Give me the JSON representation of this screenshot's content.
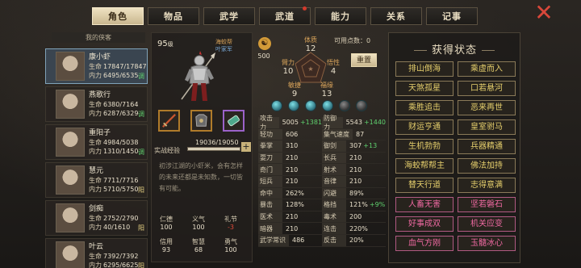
{
  "tabs": [
    {
      "label": "角色",
      "active": true
    },
    {
      "label": "物品"
    },
    {
      "label": "武学"
    },
    {
      "label": "武道",
      "badge": true
    },
    {
      "label": "能力"
    },
    {
      "label": "关系"
    },
    {
      "label": "记事"
    }
  ],
  "close_icon": "close-x-icon",
  "roster": {
    "title": "我的侠客",
    "members": [
      {
        "name": "康小虾",
        "hp": "17847/17847",
        "mp": "6495/6535",
        "tag": "调",
        "selected": true
      },
      {
        "name": "燕歌行",
        "hp": "6380/7164",
        "mp": "6287/6329",
        "tag": "调"
      },
      {
        "name": "重阳子",
        "hp": "4984/5038",
        "mp": "1310/1450",
        "tag": "调"
      },
      {
        "name": "慧元",
        "hp": "7711/7716",
        "mp": "5710/5750",
        "tag": "阳"
      },
      {
        "name": "剑痴",
        "hp": "2752/2790",
        "mp": "40/1610",
        "tag": "阳"
      },
      {
        "name": "叶云",
        "hp": "7392/7392",
        "mp": "6295/6625",
        "tag": "阳"
      }
    ],
    "hp_label": "生命",
    "mp_label": "内力"
  },
  "character": {
    "level": "95",
    "level_unit": "级",
    "sect": "海蛟帮",
    "sect_title": "叶家军",
    "exp_label": "实战经验",
    "exp_text": "19036/19050",
    "exp_fraction": 0.999,
    "description": "初涉江湖的小虾米，会有怎样的未来还都是未知数，一切皆有可能。",
    "virtues": [
      {
        "label": "仁德",
        "value": "100"
      },
      {
        "label": "义气",
        "value": "100"
      },
      {
        "label": "礼节",
        "value": "-3",
        "negative": true
      },
      {
        "label": "信用",
        "value": "93"
      },
      {
        "label": "智慧",
        "value": "68"
      },
      {
        "label": "勇气",
        "value": "100"
      }
    ]
  },
  "attributes": {
    "potential_value": "500",
    "free_points": "可用点数：0",
    "reset_label": "重置",
    "stats": {
      "physique": {
        "label": "体质",
        "value": "12"
      },
      "strength": {
        "label": "臂力",
        "value": "10"
      },
      "insight": {
        "label": "悟性",
        "value": "4"
      },
      "agility": {
        "label": "敏捷",
        "value": "9"
      },
      "fortune": {
        "label": "福缘",
        "value": "13"
      }
    }
  },
  "combat_stats": [
    [
      {
        "k": "攻击力",
        "v": "5005",
        "b": "+1381",
        "wide": true
      },
      {
        "k": "防御力",
        "v": "5543",
        "b": "+1440",
        "wide": true
      }
    ],
    [
      {
        "k": "轻功",
        "v": "606"
      },
      {
        "k": "集气速度",
        "v": "87",
        "wide": true
      }
    ],
    [
      {
        "k": "拳掌",
        "v": "310"
      },
      {
        "k": "御剑",
        "v": "307",
        "b": "+13"
      }
    ],
    [
      {
        "k": "耍刀",
        "v": "210"
      },
      {
        "k": "长兵",
        "v": "210"
      }
    ],
    [
      {
        "k": "奇门",
        "v": "210"
      },
      {
        "k": "射术",
        "v": "210"
      }
    ],
    [
      {
        "k": "短兵",
        "v": "210"
      },
      {
        "k": "音律",
        "v": "210"
      }
    ],
    [
      {
        "k": "命中",
        "v": "262%"
      },
      {
        "k": "闪避",
        "v": "89%"
      }
    ],
    [
      {
        "k": "暴击",
        "v": "128%"
      },
      {
        "k": "格挡",
        "v": "121%",
        "b": "+9%"
      }
    ],
    [
      {
        "k": "医术",
        "v": "210"
      },
      {
        "k": "毒术",
        "v": "200"
      }
    ],
    [
      {
        "k": "暗器",
        "v": "210"
      },
      {
        "k": "连击",
        "v": "220%"
      }
    ],
    [
      {
        "k": "武学常识",
        "v": "486",
        "wide": true
      },
      {
        "k": "反击",
        "v": "20%"
      }
    ]
  ],
  "status": {
    "title": "获得状态",
    "items": [
      {
        "label": "排山倒海",
        "color": "gold"
      },
      {
        "label": "乘虚而入",
        "color": "gold"
      },
      {
        "label": "天煞孤星",
        "color": "gold"
      },
      {
        "label": "口若悬河",
        "color": "gold"
      },
      {
        "label": "乘胜追击",
        "color": "gold"
      },
      {
        "label": "恶来再世",
        "color": "gold"
      },
      {
        "label": "财运亨通",
        "color": "gold"
      },
      {
        "label": "皇室驸马",
        "color": "gold"
      },
      {
        "label": "生机勃勃",
        "color": "gold"
      },
      {
        "label": "兵器精通",
        "color": "gold"
      },
      {
        "label": "海蛟帮帮主",
        "color": "gold"
      },
      {
        "label": "佛法加持",
        "color": "gold"
      },
      {
        "label": "替天行道",
        "color": "gold"
      },
      {
        "label": "志得意满",
        "color": "gold"
      },
      {
        "label": "人畜无害",
        "color": "pink"
      },
      {
        "label": "坚若磐石",
        "color": "pink"
      },
      {
        "label": "好事成双",
        "color": "pink"
      },
      {
        "label": "机关应变",
        "color": "pink"
      },
      {
        "label": "血气方刚",
        "color": "pink"
      },
      {
        "label": "玉髓冰心",
        "color": "pink"
      }
    ]
  }
}
